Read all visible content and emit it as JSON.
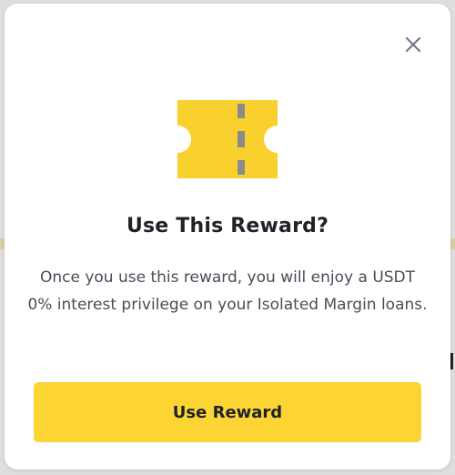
{
  "dialog": {
    "title": "Use This Reward?",
    "description": "Once you use this reward, you will enjoy a USDT 0% interest privilege on your Isolated Margin loans.",
    "primary_button_label": "Use Reward",
    "close_icon": "close-icon",
    "reward_icon": "ticket-icon"
  },
  "colors": {
    "accent": "#FCD535",
    "ticket_yellow": "#F8D12F",
    "ticket_divider": "#8A8A8A",
    "title_text": "#1E2329",
    "body_text": "#474D57"
  }
}
